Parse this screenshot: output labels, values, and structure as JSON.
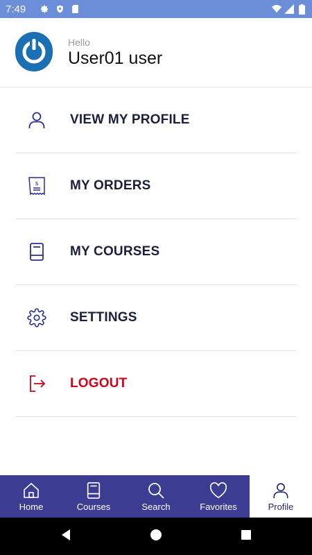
{
  "status_bar": {
    "time": "7:49",
    "icons_left": [
      "gear-icon",
      "shield-icon",
      "sd-card-icon"
    ],
    "icons_right": [
      "wifi-icon",
      "signal-icon",
      "battery-icon"
    ]
  },
  "header": {
    "greeting": "Hello",
    "username": "User01 user",
    "avatar_icon": "power-icon",
    "avatar_color": "#1b6fb3"
  },
  "menu": {
    "items": [
      {
        "label": "VIEW MY PROFILE",
        "icon": "person-icon"
      },
      {
        "label": "MY ORDERS",
        "icon": "receipt-icon"
      },
      {
        "label": "MY COURSES",
        "icon": "book-icon"
      },
      {
        "label": "SETTINGS",
        "icon": "gear-icon"
      },
      {
        "label": "LOGOUT",
        "icon": "logout-icon"
      }
    ],
    "text_color": "#1a1f3c",
    "logout_color": "#d0021b"
  },
  "bottom_nav": {
    "items": [
      {
        "label": "Home",
        "icon": "home-icon"
      },
      {
        "label": "Courses",
        "icon": "book-icon"
      },
      {
        "label": "Search",
        "icon": "search-icon"
      },
      {
        "label": "Favorites",
        "icon": "heart-icon"
      },
      {
        "label": "Profile",
        "icon": "person-icon"
      }
    ],
    "active": "Profile",
    "background": "#3c3c93"
  },
  "system_nav": {
    "buttons": [
      "back-icon",
      "home-circle-icon",
      "recents-icon"
    ]
  }
}
